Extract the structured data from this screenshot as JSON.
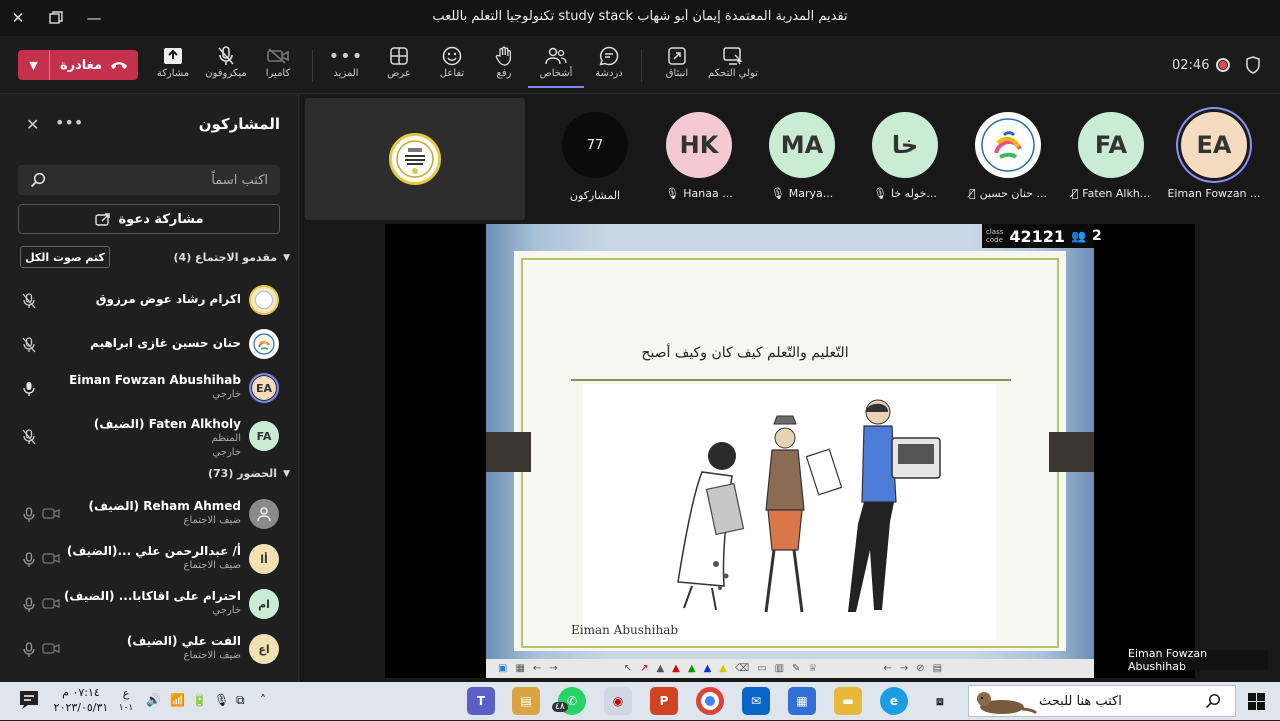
{
  "window": {
    "title": "تكنولوجيا التعلم باللعب study stack تقديم المدربة المعتمدة إيمان أبو شهاب"
  },
  "toolbar": {
    "leave_label": "مغادرة",
    "buttons": [
      {
        "key": "share",
        "label": "مشاركة",
        "icon": "share-tray-icon"
      },
      {
        "key": "mic",
        "label": "ميكروفون",
        "icon": "mic-off-icon"
      },
      {
        "key": "camera",
        "label": "كاميرا",
        "icon": "camera-off-icon"
      },
      {
        "key": "more",
        "label": "المزيد",
        "icon": "more-dots-icon"
      },
      {
        "key": "view",
        "label": "عرض",
        "icon": "grid-view-icon"
      },
      {
        "key": "react",
        "label": "تفاعل",
        "icon": "smiley-icon"
      },
      {
        "key": "raise",
        "label": "رفع",
        "icon": "raise-hand-icon"
      },
      {
        "key": "people",
        "label": "أشخاص",
        "icon": "people-icon"
      },
      {
        "key": "chat",
        "label": "دردشة",
        "icon": "chat-icon"
      },
      {
        "key": "popout",
        "label": "انبثاق",
        "icon": "popout-icon"
      },
      {
        "key": "control",
        "label": "تولي التحكم",
        "icon": "take-control-icon"
      }
    ],
    "timer": "02:46"
  },
  "participants_panel": {
    "title": "المشاركون",
    "search_placeholder": "اكتب اسماً",
    "invite_label": "مشاركة دعوة",
    "presenters_header": "مقدمو الاجتماع (4)",
    "mute_all_label": "كتم صوت الكل",
    "attendees_header": "الحضور (73)",
    "presenters": [
      {
        "name": "اكرام رشاد عوض مرزوق",
        "sub1": "",
        "sub2": "",
        "avatar": "",
        "avatar_bg": "#f1e7c2"
      },
      {
        "name": "حنان حسين غازى ابراهيم",
        "sub1": "",
        "sub2": "",
        "avatar": "",
        "avatar_bg": "#ffffff"
      },
      {
        "name": "Eiman Fowzan Abushihab",
        "sub1": "خارجي",
        "sub2": "",
        "avatar": "EA",
        "avatar_bg": "#f5dcc0"
      },
      {
        "name": "Faten Alkholy (الضيف)",
        "sub1": "المنظم",
        "sub2": "خارجي",
        "avatar": "FA",
        "avatar_bg": "#c9ecd3"
      }
    ],
    "attendees": [
      {
        "name": "Reham Ahmed (الضيف)",
        "sub1": "ضيف الاجتماع",
        "avatar": "",
        "avatar_bg": "#8a8a8a"
      },
      {
        "name": "أ/ عبدالرحمن علي ...(الضيف)",
        "sub1": "ضيف الاجتماع",
        "avatar": "أا",
        "avatar_bg": "#f3e1b3"
      },
      {
        "name": "احترام على اقاكابا...  (الضيف)",
        "sub1": "خارجي",
        "avatar": "ام",
        "avatar_bg": "#c9ecd3"
      },
      {
        "name": "الفت علي (الضيف)",
        "sub1": "ضيف الاجتماع",
        "avatar": "اع",
        "avatar_bg": "#f3e1b3"
      }
    ]
  },
  "stage": {
    "participants_count": "77",
    "participants_label": "المشاركون",
    "tiles": [
      {
        "initials": "EA",
        "label": "Eiman Fowzan ...",
        "bg": "#f5dcc0",
        "ring": true
      },
      {
        "initials": "FA",
        "label": "Faten Alkh...",
        "bg": "#c9ecd3",
        "ring": false
      },
      {
        "initials": "",
        "label": "حنان حسين ...",
        "bg": "#ffffff",
        "ring": false
      },
      {
        "initials": "خا",
        "label": "خوله خا...",
        "bg": "#c9ecd3",
        "ring": false
      },
      {
        "initials": "MA",
        "label": "Marya...",
        "bg": "#c9ecd3",
        "ring": false
      },
      {
        "initials": "HK",
        "label": "Hanaa ...",
        "bg": "#f5c9d3",
        "ring": false
      }
    ],
    "class_code_label_1": "class",
    "class_code_label_2": "code",
    "class_code": "42121",
    "class_count": "2",
    "slide_title": "التّعليم والتّعلم كيف كان وكيف أصبح",
    "slide_signature": "Eiman Abushihab",
    "presenter_caption": "Eiman Fowzan Abushihab"
  },
  "taskbar": {
    "search_placeholder": "اكتب هنا للبحث",
    "time": "٠٧:١٤ م",
    "date": "٢٠٢٣/٠٥/٣١",
    "keyboard": "ع",
    "kb_sub": "١٠١",
    "whatsapp_badge": "٤٨"
  }
}
